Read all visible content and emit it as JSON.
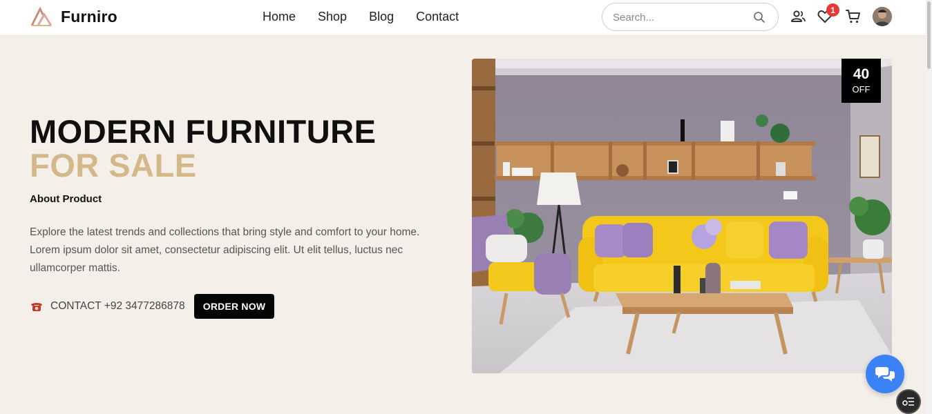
{
  "brand": {
    "name": "Furniro"
  },
  "nav": {
    "items": [
      "Home",
      "Shop",
      "Blog",
      "Contact"
    ]
  },
  "search": {
    "placeholder": "Search..."
  },
  "header": {
    "wishlist_count": "1"
  },
  "hero": {
    "title_line1": "MODERN FURNITURE",
    "title_line2": "FOR SALE",
    "about_label": "About Product",
    "description": "Explore the latest trends and collections that bring style and comfort to your home. Lorem ipsum dolor sit amet, consectetur adipiscing elit. Ut elit tellus, luctus nec ullamcorper mattis.",
    "contact_text": "CONTACT +92 3477286878",
    "order_button": "ORDER NOW"
  },
  "discount": {
    "value": "40",
    "label": "OFF"
  },
  "colors": {
    "accent": "#d4b88a",
    "background": "#f4f0e9",
    "chat": "#3b82f6",
    "badge": "#e53935"
  },
  "icons": [
    "logo-icon",
    "search-icon",
    "user-icon",
    "heart-icon",
    "cart-icon",
    "phone-icon",
    "chat-icon",
    "menu-icon"
  ]
}
